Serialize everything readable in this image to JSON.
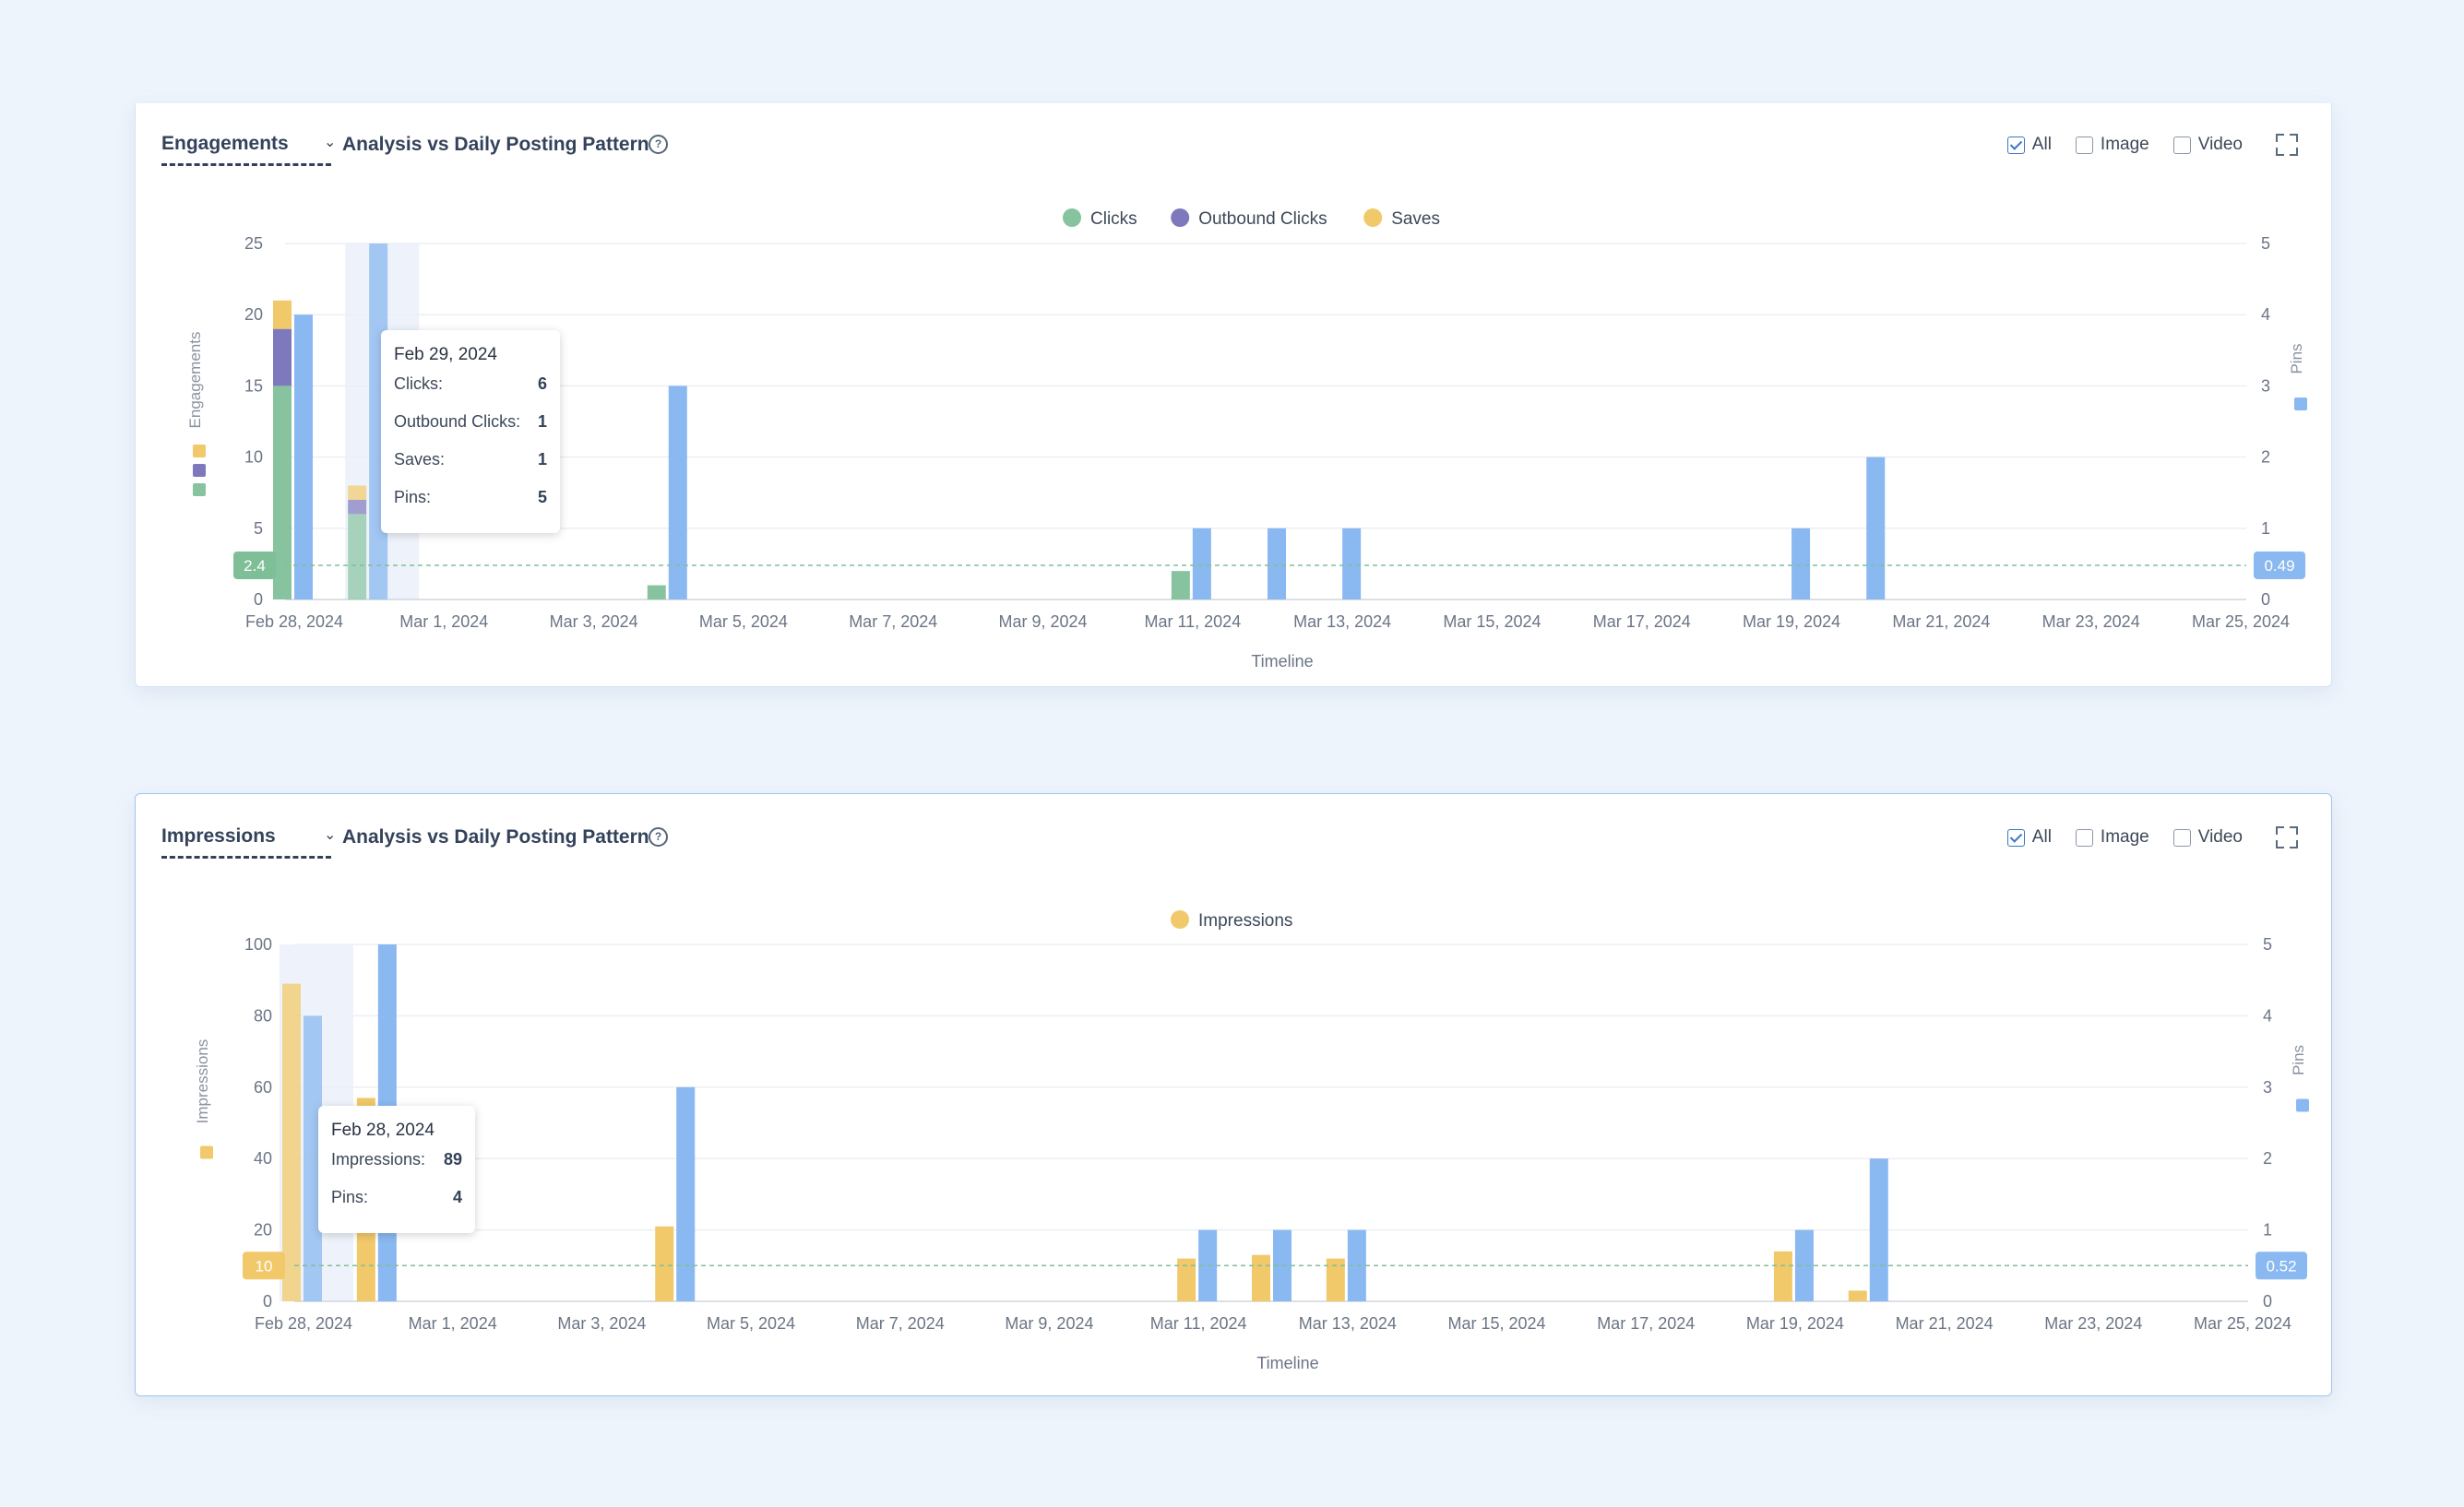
{
  "colors": {
    "clicks": "#88c3a0",
    "outbound": "#7d79bc",
    "saves": "#f2c96a",
    "impressions": "#f2c96a",
    "pins": "#8ab8f0",
    "avg_eng": "#7fbf98",
    "avg_imp": "#f2c96a",
    "avg_pins": "#8ab8f0"
  },
  "filters": {
    "all": "All",
    "image": "Image",
    "video": "Video"
  },
  "engagements": {
    "metric": "Engagements",
    "subtitle": "Analysis vs Daily Posting Pattern",
    "tooltip": {
      "date": "Feb 29, 2024",
      "rows": [
        {
          "label": "Clicks:",
          "value": "6"
        },
        {
          "label": "Outbound Clicks:",
          "value": "1"
        },
        {
          "label": "Saves:",
          "value": "1"
        },
        {
          "label": "Pins:",
          "value": "5"
        }
      ]
    }
  },
  "impressions": {
    "metric": "Impressions",
    "subtitle": "Analysis vs Daily Posting Pattern",
    "tooltip": {
      "date": "Feb 28, 2024",
      "rows": [
        {
          "label": "Impressions:",
          "value": "89"
        },
        {
          "label": "Pins:",
          "value": "4"
        }
      ]
    }
  },
  "chart_data": [
    {
      "type": "bar",
      "xlabel": "Timeline",
      "ylabel": "Engagements",
      "y2label": "Pins",
      "ylim": [
        0,
        25
      ],
      "y2lim": [
        0,
        5
      ],
      "yticks": [
        0,
        5,
        10,
        15,
        20,
        25
      ],
      "y2ticks": [
        0,
        1,
        2,
        3,
        4,
        5
      ],
      "xticks": [
        "Feb 28, 2024",
        "Mar 1, 2024",
        "Mar 3, 2024",
        "Mar 5, 2024",
        "Mar 7, 2024",
        "Mar 9, 2024",
        "Mar 11, 2024",
        "Mar 13, 2024",
        "Mar 15, 2024",
        "Mar 17, 2024",
        "Mar 19, 2024",
        "Mar 21, 2024",
        "Mar 23, 2024",
        "Mar 25, 2024"
      ],
      "legend": [
        "Clicks",
        "Outbound Clicks",
        "Saves"
      ],
      "legend_position": "top-center",
      "dates": [
        "Feb 28",
        "Feb 29",
        "Mar 4",
        "Mar 11",
        "Mar 12",
        "Mar 13",
        "Mar 19",
        "Mar 20"
      ],
      "series": [
        {
          "name": "Clicks",
          "axis": "left",
          "stack": "eng",
          "values": [
            15,
            6,
            1,
            2,
            0,
            0,
            0,
            0
          ]
        },
        {
          "name": "Outbound Clicks",
          "axis": "left",
          "stack": "eng",
          "values": [
            4,
            1,
            0,
            0,
            0,
            0,
            0,
            0
          ]
        },
        {
          "name": "Saves",
          "axis": "left",
          "stack": "eng",
          "values": [
            2,
            1,
            0,
            0,
            0,
            0,
            0,
            0
          ]
        },
        {
          "name": "Pins",
          "axis": "right",
          "values": [
            4,
            5,
            3,
            1,
            1,
            1,
            1,
            2
          ]
        }
      ],
      "avg_left": 2.4,
      "avg_right": 0.49,
      "highlight": "Feb 29",
      "grid": true
    },
    {
      "type": "bar",
      "xlabel": "Timeline",
      "ylabel": "Impressions",
      "y2label": "Pins",
      "ylim": [
        0,
        100
      ],
      "y2lim": [
        0,
        5
      ],
      "yticks": [
        0,
        20,
        40,
        60,
        80,
        100
      ],
      "y2ticks": [
        0,
        1,
        2,
        3,
        4,
        5
      ],
      "xticks": [
        "Feb 28, 2024",
        "Mar 1, 2024",
        "Mar 3, 2024",
        "Mar 5, 2024",
        "Mar 7, 2024",
        "Mar 9, 2024",
        "Mar 11, 2024",
        "Mar 13, 2024",
        "Mar 15, 2024",
        "Mar 17, 2024",
        "Mar 19, 2024",
        "Mar 21, 2024",
        "Mar 23, 2024",
        "Mar 25, 2024"
      ],
      "legend": [
        "Impressions"
      ],
      "legend_position": "top-center",
      "dates": [
        "Feb 28",
        "Feb 29",
        "Mar 4",
        "Mar 11",
        "Mar 12",
        "Mar 13",
        "Mar 19",
        "Mar 20"
      ],
      "series": [
        {
          "name": "Impressions",
          "axis": "left",
          "values": [
            89,
            57,
            21,
            12,
            13,
            12,
            14,
            3
          ]
        },
        {
          "name": "Pins",
          "axis": "right",
          "values": [
            4,
            5,
            3,
            1,
            1,
            1,
            1,
            2
          ]
        }
      ],
      "avg_left": 10,
      "avg_right": 0.52,
      "highlight": "Feb 28",
      "grid": true
    }
  ]
}
